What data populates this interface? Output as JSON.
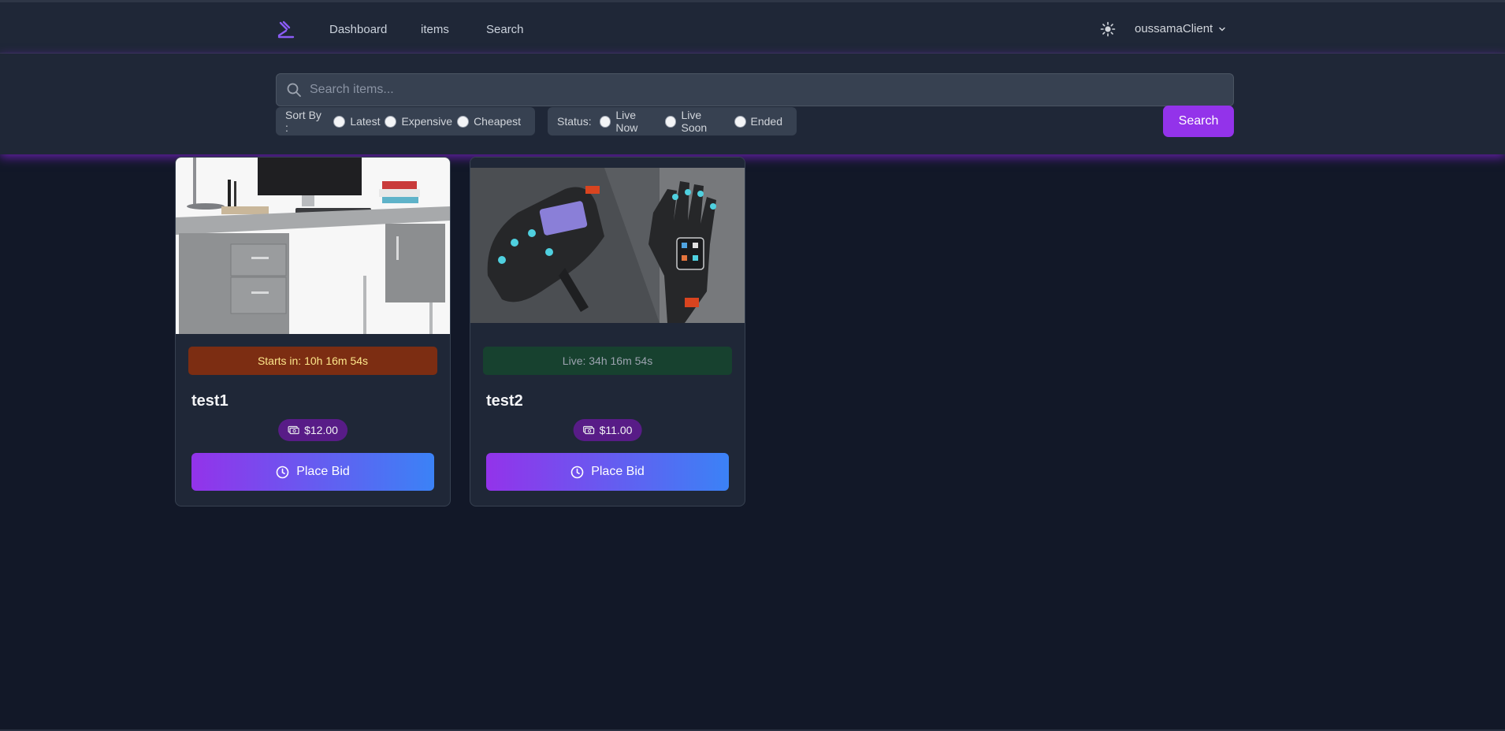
{
  "nav": {
    "links": [
      "Dashboard",
      "items",
      "Search"
    ],
    "username": "oussamaClient",
    "icons": {
      "logo": "gavel-icon",
      "theme": "sun-icon",
      "caret": "chevron-down-icon"
    }
  },
  "search": {
    "placeholder": "Search items...",
    "button_label": "Search",
    "sort": {
      "label": "Sort By :",
      "options": [
        "Latest",
        "Expensive",
        "Cheapest"
      ],
      "selected": null
    },
    "status": {
      "label": "Status:",
      "options": [
        "Live Now",
        "Live Soon",
        "Ended"
      ],
      "selected": null
    }
  },
  "items": [
    {
      "title": "test1",
      "timer": "Starts in: 10h 16m 54s",
      "timer_state": "soon",
      "price": "$12.00",
      "button_label": "Place Bid",
      "image": "office desk with monitor"
    },
    {
      "title": "test2",
      "timer": "Live: 34h 16m 54s",
      "timer_state": "live",
      "price": "$11.00",
      "button_label": "Place Bid",
      "image": "pair of smart gloves"
    }
  ],
  "colors": {
    "background": "#121828",
    "panel": "#1f2737",
    "accent": "#9333ea",
    "gradient_end": "#3b82f6",
    "timer_soon": "#7c2d12",
    "timer_live": "#17412f"
  }
}
